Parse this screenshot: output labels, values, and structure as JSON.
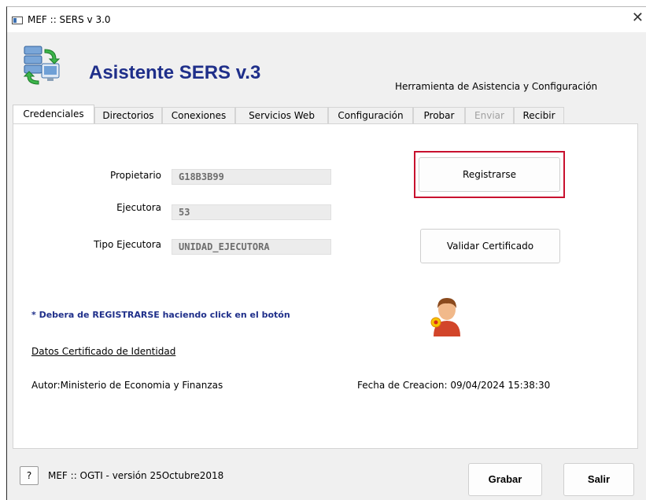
{
  "window": {
    "title": "MEF :: SERS v 3.0",
    "close_glyph": "✕"
  },
  "header": {
    "app_title": "Asistente SERS v.3",
    "subtitle": "Herramienta de Asistencia y Configuración",
    "logo_icon": "servers-sync-icon"
  },
  "tabs": [
    {
      "label": "Credenciales",
      "active": true,
      "disabled": false
    },
    {
      "label": "Directorios",
      "active": false,
      "disabled": false
    },
    {
      "label": "Conexiones",
      "active": false,
      "disabled": false
    },
    {
      "label": "Servicios Web",
      "active": false,
      "disabled": false
    },
    {
      "label": "Configuración",
      "active": false,
      "disabled": false
    },
    {
      "label": "Probar",
      "active": false,
      "disabled": false
    },
    {
      "label": "Enviar",
      "active": false,
      "disabled": true
    },
    {
      "label": "Recibir",
      "active": false,
      "disabled": false
    }
  ],
  "credenciales": {
    "propietario": {
      "label": "Propietario",
      "value": "G18B3B99"
    },
    "ejecutora": {
      "label": "Ejecutora",
      "value": "53"
    },
    "tipo_ejecutora": {
      "label": "Tipo Ejecutora",
      "value": "UNIDAD_EJECUTORA"
    },
    "registrarse_label": "Registrarse",
    "validar_label": "Validar Certificado",
    "note": "* Debera de REGISTRARSE haciendo click en el botón",
    "certificate_link": "Datos Certificado de Identidad",
    "author": "Autor:Ministerio de Economia y Finanzas",
    "creation_date": "Fecha de Creacion: 09/04/2024 15:38:30",
    "user_icon": "user-certificate-icon",
    "highlight_color": "#c8102e"
  },
  "footer": {
    "help_label": "?",
    "version": "MEF :: OGTI - versión 25Octubre2018",
    "grabar_label": "Grabar",
    "salir_label": "Salir"
  },
  "colors": {
    "title_blue": "#1f2f8a",
    "window_bg": "#f0f0f0",
    "panel_bg": "#ffffff"
  }
}
